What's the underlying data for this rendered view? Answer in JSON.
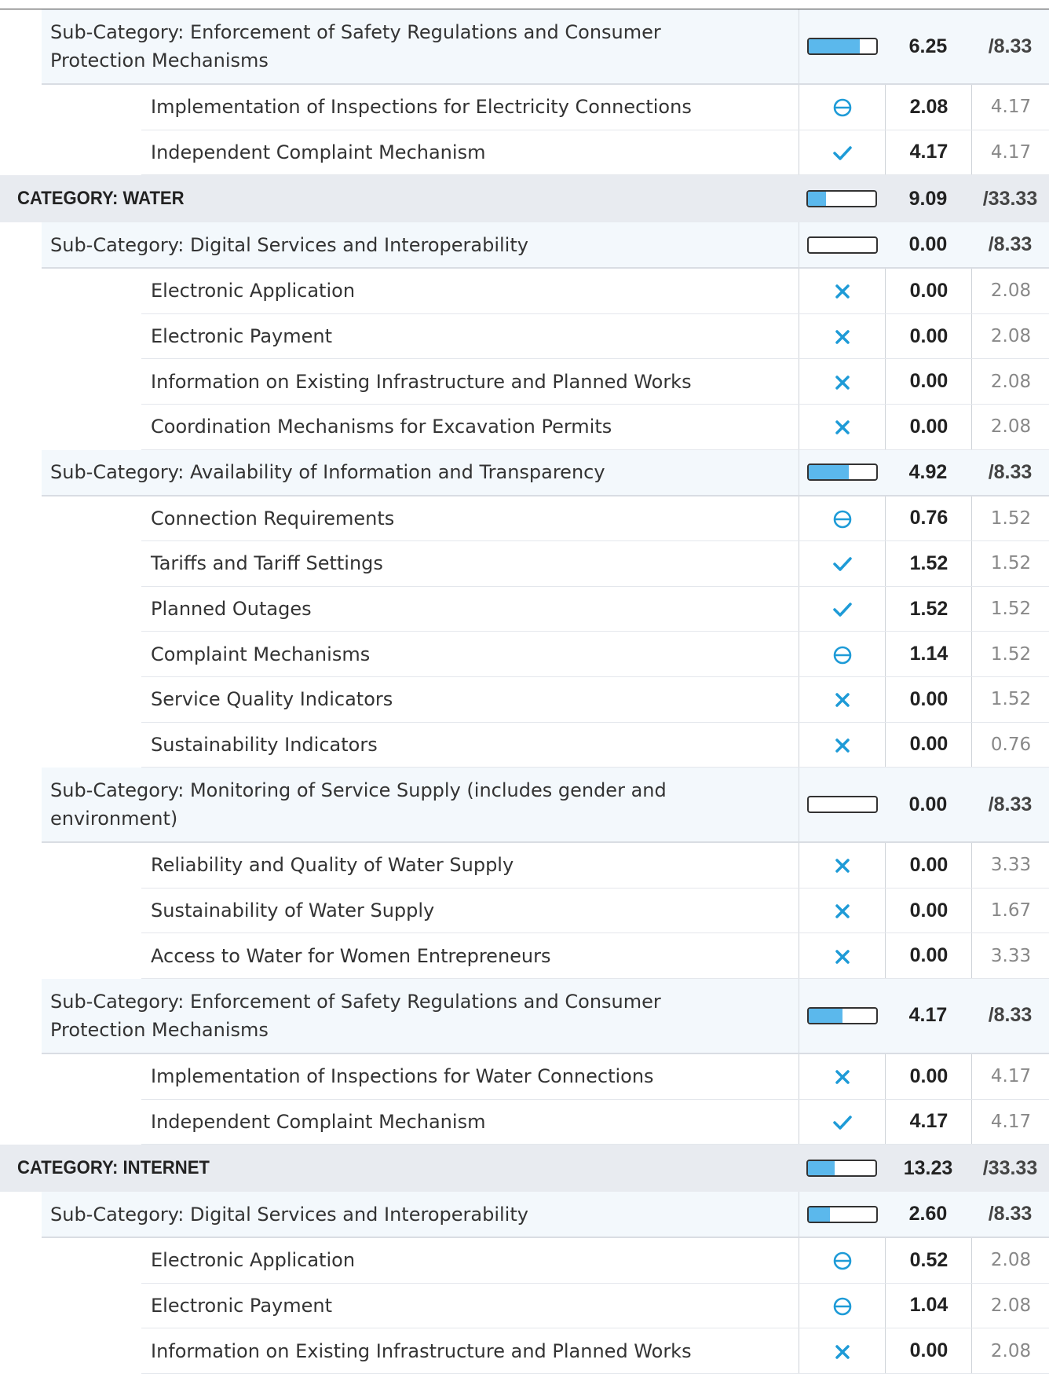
{
  "rows": [
    {
      "kind": "sub",
      "label": "Sub-Category: Enforcement of Safety Regulations and Consumer Protection Mechanisms",
      "score": "6.25",
      "max": "/8.33",
      "progress": 0.75,
      "lines": 2
    },
    {
      "kind": "ind",
      "label": "Implementation of Inspections for Electricity Connections",
      "icon": "partial-icon",
      "score": "2.08",
      "max": "4.17"
    },
    {
      "kind": "ind",
      "label": "Independent Complaint Mechanism",
      "icon": "check-icon",
      "score": "4.17",
      "max": "4.17"
    },
    {
      "kind": "cat",
      "label": "CATEGORY: WATER",
      "score": "9.09",
      "max": "/33.33",
      "progress": 0.27
    },
    {
      "kind": "sub",
      "label": "Sub-Category: Digital Services and Interoperability",
      "score": "0.00",
      "max": "/8.33",
      "progress": 0,
      "lines": 1
    },
    {
      "kind": "ind",
      "label": "Electronic Application",
      "icon": "cross-icon",
      "score": "0.00",
      "max": "2.08"
    },
    {
      "kind": "ind",
      "label": "Electronic Payment",
      "icon": "cross-icon",
      "score": "0.00",
      "max": "2.08"
    },
    {
      "kind": "ind",
      "label": "Information on Existing Infrastructure and Planned Works",
      "icon": "cross-icon",
      "score": "0.00",
      "max": "2.08"
    },
    {
      "kind": "ind",
      "label": "Coordination Mechanisms for Excavation Permits",
      "icon": "cross-icon",
      "score": "0.00",
      "max": "2.08"
    },
    {
      "kind": "sub",
      "label": "Sub-Category: Availability of Information and Transparency",
      "score": "4.92",
      "max": "/8.33",
      "progress": 0.59,
      "lines": 1
    },
    {
      "kind": "ind",
      "label": "Connection Requirements",
      "icon": "partial-icon",
      "score": "0.76",
      "max": "1.52"
    },
    {
      "kind": "ind",
      "label": "Tariffs and Tariff Settings",
      "icon": "check-icon",
      "score": "1.52",
      "max": "1.52"
    },
    {
      "kind": "ind",
      "label": "Planned Outages",
      "icon": "check-icon",
      "score": "1.52",
      "max": "1.52"
    },
    {
      "kind": "ind",
      "label": "Complaint Mechanisms",
      "icon": "partial-icon",
      "score": "1.14",
      "max": "1.52"
    },
    {
      "kind": "ind",
      "label": "Service Quality Indicators",
      "icon": "cross-icon",
      "score": "0.00",
      "max": "1.52"
    },
    {
      "kind": "ind",
      "label": "Sustainability Indicators",
      "icon": "cross-icon",
      "score": "0.00",
      "max": "0.76"
    },
    {
      "kind": "sub",
      "label": "Sub-Category: Monitoring of Service Supply (includes gender and environment)",
      "score": "0.00",
      "max": "/8.33",
      "progress": 0,
      "lines": 2
    },
    {
      "kind": "ind",
      "label": "Reliability and Quality of Water Supply",
      "icon": "cross-icon",
      "score": "0.00",
      "max": "3.33"
    },
    {
      "kind": "ind",
      "label": "Sustainability of Water Supply",
      "icon": "cross-icon",
      "score": "0.00",
      "max": "1.67"
    },
    {
      "kind": "ind",
      "label": "Access to Water for Women Entrepreneurs",
      "icon": "cross-icon",
      "score": "0.00",
      "max": "3.33"
    },
    {
      "kind": "sub",
      "label": "Sub-Category: Enforcement of Safety Regulations and Consumer Protection Mechanisms",
      "score": "4.17",
      "max": "/8.33",
      "progress": 0.5,
      "lines": 2
    },
    {
      "kind": "ind",
      "label": "Implementation of Inspections for Water Connections",
      "icon": "cross-icon",
      "score": "0.00",
      "max": "4.17"
    },
    {
      "kind": "ind",
      "label": "Independent Complaint Mechanism",
      "icon": "check-icon",
      "score": "4.17",
      "max": "4.17"
    },
    {
      "kind": "cat",
      "label": "CATEGORY: INTERNET",
      "score": "13.23",
      "max": "/33.33",
      "progress": 0.4
    },
    {
      "kind": "sub",
      "label": "Sub-Category: Digital Services and Interoperability",
      "score": "2.60",
      "max": "/8.33",
      "progress": 0.31,
      "lines": 1
    },
    {
      "kind": "ind",
      "label": "Electronic Application",
      "icon": "partial-icon",
      "score": "0.52",
      "max": "2.08"
    },
    {
      "kind": "ind",
      "label": "Electronic Payment",
      "icon": "partial-icon",
      "score": "1.04",
      "max": "2.08"
    },
    {
      "kind": "ind",
      "label": "Information on Existing Infrastructure and Planned Works",
      "icon": "cross-icon",
      "score": "0.00",
      "max": "2.08"
    }
  ],
  "colors": {
    "accent": "#1e9bd7",
    "bar_fill": "#5bb8ec"
  }
}
